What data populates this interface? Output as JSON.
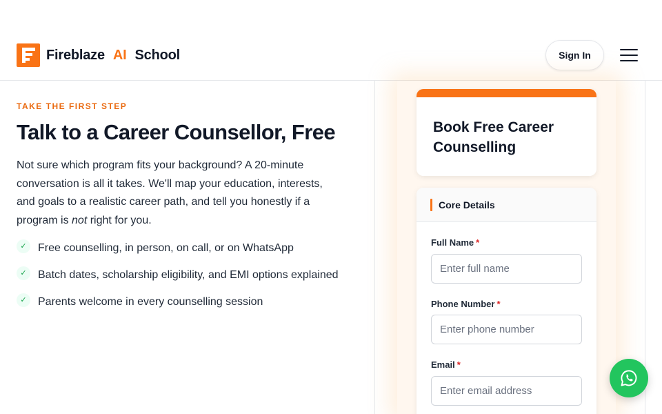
{
  "brand": {
    "name": "Fireblaze",
    "ai": "AI",
    "school": "School"
  },
  "nav": {
    "signin_label": "Sign In"
  },
  "hero": {
    "eyebrow": "TAKE THE FIRST STEP",
    "title": "Talk to a Career Counsellor, Free",
    "intro_before": "Not sure which program fits your background? A 20-minute conversation is all it takes. We'll map your education, interests, and goals to a realistic career path, and tell you honestly if a program is ",
    "intro_em": "not",
    "intro_after": " right for you.",
    "bullets": [
      "Free counselling, in person, on call, or on WhatsApp",
      "Batch dates, scholarship eligibility, and EMI options explained",
      "Parents welcome in every counselling session"
    ]
  },
  "form": {
    "card_title": "Book Free Career Counselling",
    "section_title": "Core Details",
    "required_marker": "*",
    "fields": [
      {
        "label": "Full Name",
        "placeholder": "Enter full name"
      },
      {
        "label": "Phone Number",
        "placeholder": "Enter phone number"
      },
      {
        "label": "Email",
        "placeholder": "Enter email address"
      }
    ]
  },
  "colors": {
    "accent": "#f97316",
    "whatsapp": "#22c55e",
    "required": "#dc2626"
  },
  "icons": {
    "menu": "hamburger-menu-icon",
    "check": "check-icon",
    "whatsapp": "whatsapp-icon"
  }
}
